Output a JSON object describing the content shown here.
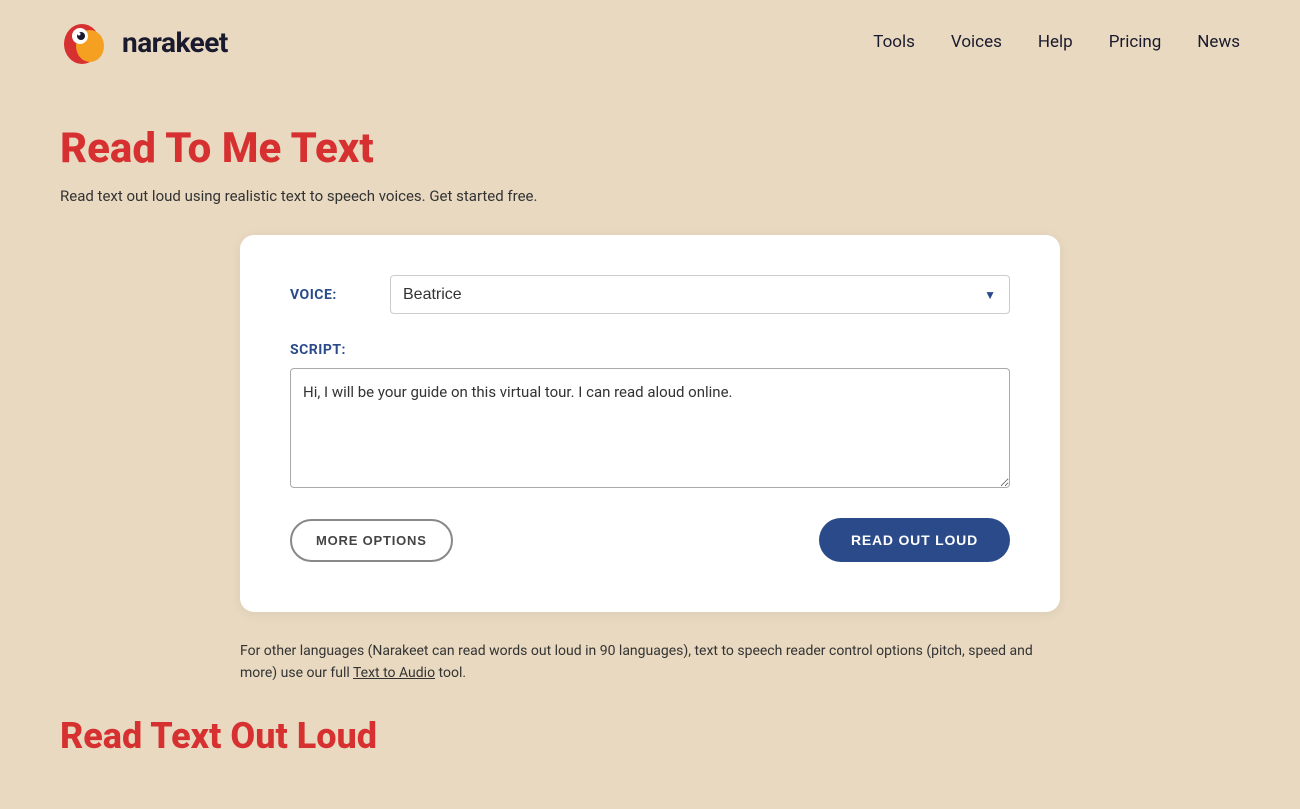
{
  "logo": {
    "text": "narakeet"
  },
  "nav": {
    "items": [
      {
        "label": "Tools",
        "href": "#"
      },
      {
        "label": "Voices",
        "href": "#"
      },
      {
        "label": "Help",
        "href": "#"
      },
      {
        "label": "Pricing",
        "href": "#"
      },
      {
        "label": "News",
        "href": "#"
      }
    ]
  },
  "page": {
    "title": "Read To Me Text",
    "subtitle": "Read text out loud using realistic text to speech voices. Get started free.",
    "footer_note": "For other languages (Narakeet can read words out loud in 90 languages), text to speech reader control options (pitch, speed and more) use our full ",
    "footer_link": "Text to Audio",
    "footer_end": " tool.",
    "second_title": "Read Text Out Loud"
  },
  "form": {
    "voice_label": "VOICE:",
    "voice_value": "Beatrice",
    "script_label": "SCRIPT:",
    "script_value": "Hi, I will be your guide on this virtual tour. I can read aloud online.",
    "more_options_label": "MORE OPTIONS",
    "read_out_loud_label": "READ OUT LOUD"
  }
}
